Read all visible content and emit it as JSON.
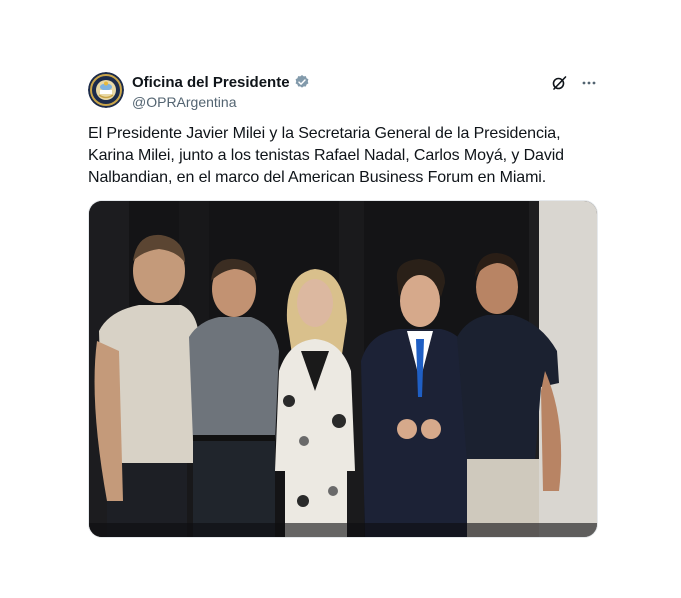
{
  "tweet": {
    "display_name": "Oficina del Presidente",
    "handle": "@OPRArgentina",
    "text": "El Presidente Javier Milei y la Secretaria General de la Presidencia, Karina Milei, junto a los tenistas Rafael Nadal, Carlos Moyá, y David Nalbandian, en el marco del American Business Forum en Miami.",
    "verified_color": "#829aab"
  },
  "icons": {
    "avatar": "presidential-seal-icon",
    "verified": "verified-badge-icon",
    "grok": "grok-icon",
    "more": "more-icon"
  }
}
